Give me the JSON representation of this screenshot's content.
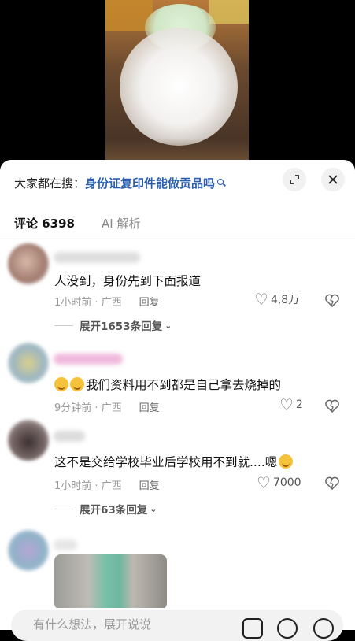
{
  "search": {
    "prefix": "大家都在搜：",
    "term": "身份证复印件能做贡品吗"
  },
  "tabs": [
    {
      "label": "评论 6398"
    },
    {
      "label": "AI 解析"
    }
  ],
  "comments": [
    {
      "text": "人没到，身份先到下面报道",
      "time": "1小时前 · 广西",
      "reply": "回复",
      "likes": "4,8万",
      "expand": "展开1653条回复"
    },
    {
      "text": "我们资料用不到都是自己拿去烧掉的",
      "time": "9分钟前 · 广西",
      "reply": "回复",
      "likes": "2"
    },
    {
      "text": "这不是交给学校毕业后学校用不到就....嗯",
      "time": "1小时前 · 广西",
      "reply": "回复",
      "likes": "7000",
      "expand": "展开63条回复"
    }
  ],
  "input": {
    "placeholder": "有什么想法，展开说说"
  }
}
